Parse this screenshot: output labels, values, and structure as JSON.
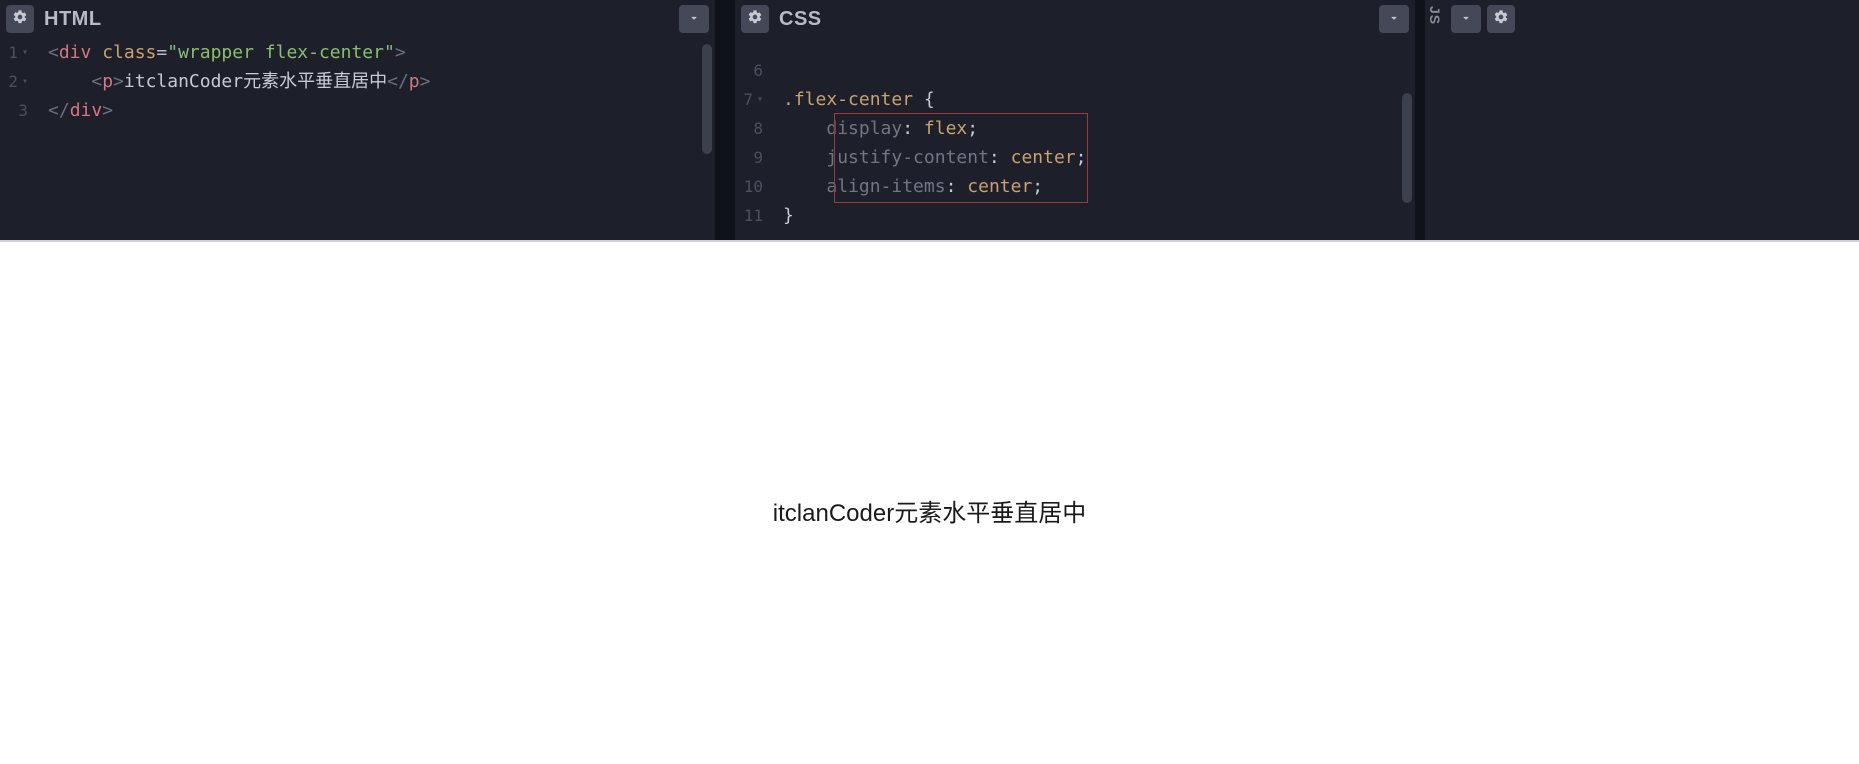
{
  "panels": {
    "html": {
      "title": "HTML"
    },
    "css": {
      "title": "CSS"
    },
    "js": {
      "label": "JS"
    }
  },
  "html_code": {
    "lines": [
      "1",
      "2",
      "3"
    ],
    "div_open_pre": "<",
    "div_tag": "div",
    "class_attr": "class",
    "eq": "=",
    "q": "\"",
    "class_val": "wrapper flex-center",
    "tag_close": ">",
    "p_open_pre": "<",
    "p_tag": "p",
    "p_text": "itclanCoder元素水平垂直居中",
    "p_close_pre": "</",
    "div_close_pre": "</"
  },
  "css_code": {
    "lines": [
      "6",
      "7",
      "8",
      "9",
      "10",
      "11"
    ],
    "selector": ".flex-center",
    "brace_open": "{",
    "brace_close": "}",
    "p1_name": "display",
    "p1_val": "flex",
    "p2_name": "justify-content",
    "p2_val": "center",
    "p3_name": "align-items",
    "p3_val": "center",
    "colon": ":",
    "semicolon": ";"
  },
  "preview": {
    "text": "itclanCoder元素水平垂直居中"
  }
}
